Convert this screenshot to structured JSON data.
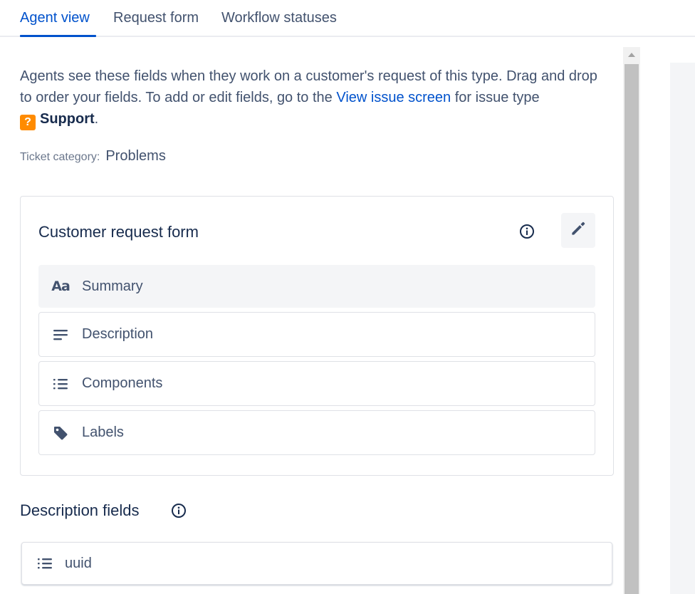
{
  "tabs": [
    {
      "label": "Agent view",
      "active": true
    },
    {
      "label": "Request form",
      "active": false
    },
    {
      "label": "Workflow statuses",
      "active": false
    }
  ],
  "intro": {
    "text_before_link": "Agents see these fields when they work on a customer's request of this type. Drag and drop to order your fields. To add or edit fields, go to the ",
    "link_text": "View issue screen",
    "text_after_link": " for issue type ",
    "issue_type_icon": "?",
    "issue_type": "Support",
    "period": "."
  },
  "ticket_category": {
    "label": "Ticket category:",
    "value": "Problems"
  },
  "customer_form": {
    "title": "Customer request form",
    "fields": [
      {
        "label": "Summary",
        "icon": "text-format-icon",
        "icon_text": "Aa"
      },
      {
        "label": "Description",
        "icon": "description-lines-icon"
      },
      {
        "label": "Components",
        "icon": "bulleted-list-icon"
      },
      {
        "label": "Labels",
        "icon": "label-tag-icon"
      }
    ]
  },
  "description_fields": {
    "title": "Description fields",
    "items": [
      {
        "label": "uuid",
        "icon": "bulleted-list-icon"
      }
    ]
  },
  "colors": {
    "accent": "#0052cc",
    "issue_type_orange": "#ff8b00",
    "text_primary": "#172b4d",
    "text_secondary": "#42526e"
  }
}
